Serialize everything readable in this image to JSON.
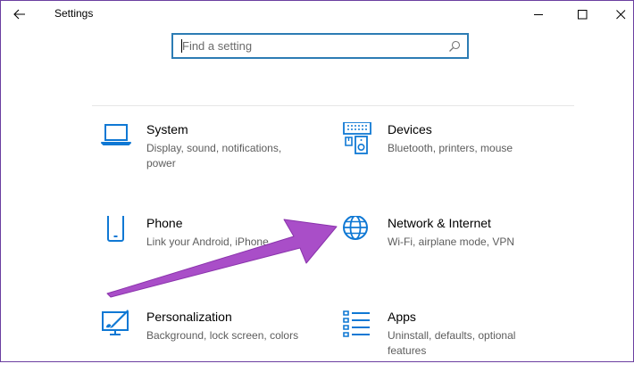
{
  "window": {
    "title": "Settings",
    "back_icon": "back-arrow-icon",
    "controls": [
      "minimize-icon",
      "maximize-icon",
      "close-icon"
    ]
  },
  "search": {
    "placeholder": "Find a setting",
    "value": "",
    "icon": "search-icon"
  },
  "tiles": [
    {
      "name": "System",
      "desc": "Display, sound, notifications, power",
      "icon": "laptop-icon"
    },
    {
      "name": "Devices",
      "desc": "Bluetooth, printers, mouse",
      "icon": "devices-icon"
    },
    {
      "name": "Phone",
      "desc": "Link your Android, iPhone",
      "icon": "phone-icon"
    },
    {
      "name": "Network & Internet",
      "desc": "Wi-Fi, airplane mode, VPN",
      "icon": "globe-icon"
    },
    {
      "name": "Personalization",
      "desc": "Background, lock screen, colors",
      "icon": "paintbrush-icon"
    },
    {
      "name": "Apps",
      "desc": "Uninstall, defaults, optional features",
      "icon": "apps-list-icon"
    }
  ],
  "colors": {
    "accent": "#0f78d4",
    "search_border": "#2c7cb4",
    "annotation_arrow": "#a94ec8",
    "frame_border": "#6b3fa0"
  },
  "annotation": {
    "type": "arrow",
    "points_to": "Network & Internet"
  }
}
